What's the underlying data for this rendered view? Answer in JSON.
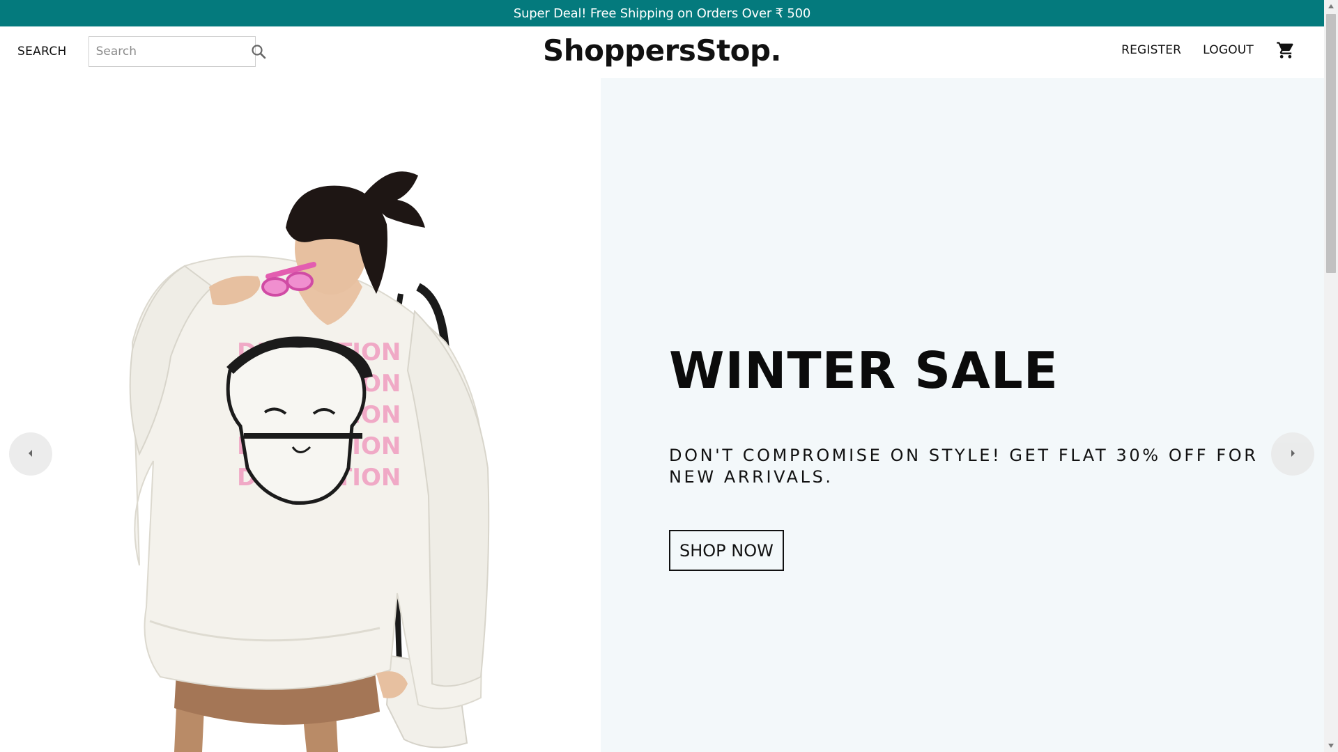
{
  "announcement": {
    "text": "Super Deal! Free Shipping on Orders Over ₹ 500"
  },
  "navbar": {
    "search_label": "SEARCH",
    "search_placeholder": "Search",
    "search_value": "",
    "logo": "ShoppersStop.",
    "register_label": "REGISTER",
    "logout_label": "LOGOUT",
    "icons": {
      "search": "search-icon",
      "cart": "shopping-cart-icon"
    }
  },
  "slider": {
    "title": "WINTER SALE",
    "description": "DON'T COMPROMISE ON STYLE! GET FLAT 30% OFF FOR NEW ARRIVALS.",
    "button_label": "SHOP NOW",
    "image_alt": "model-in-white-sweatshirt",
    "icons": {
      "prev": "chevron-left-icon",
      "next": "chevron-right-icon"
    }
  },
  "colors": {
    "announcement_bg": "#047a7d",
    "slide_bg": "#f3f8fa",
    "text": "#111111"
  }
}
